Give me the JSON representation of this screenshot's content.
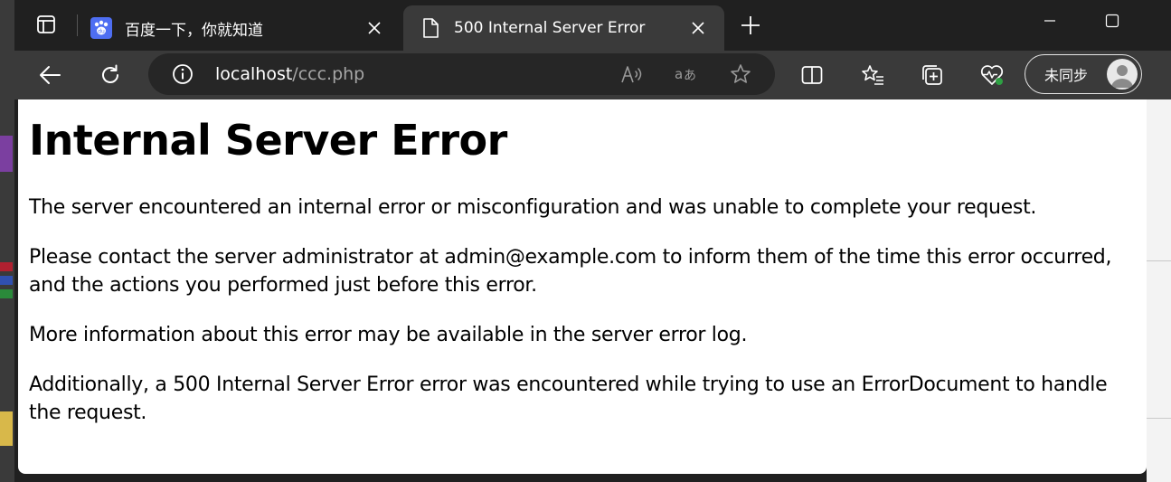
{
  "tabs": [
    {
      "title": "百度一下，你就知道",
      "favicon": "baidu-paw-icon",
      "active": false
    },
    {
      "title": "500 Internal Server Error",
      "favicon": "document-icon",
      "active": true
    }
  ],
  "address": {
    "host": "localhost",
    "path": "/ccc.php"
  },
  "profile": {
    "label": "未同步"
  },
  "page": {
    "heading": "Internal Server Error",
    "paragraphs": [
      "The server encountered an internal error or misconfiguration and was unable to complete your request.",
      "Please contact the server administrator at admin@example.com to inform them of the time this error occurred, and the actions you performed just before this error.",
      "More information about this error may be available in the server error log.",
      "Additionally, a 500 Internal Server Error error was encountered while trying to use an ErrorDocument to handle the request."
    ]
  },
  "colors": {
    "chrome_dark": "#202020",
    "toolbar": "#3a3a3a",
    "address_bg": "#262626",
    "page_bg": "#ffffff",
    "sync_status_dot": "#2ea043"
  }
}
